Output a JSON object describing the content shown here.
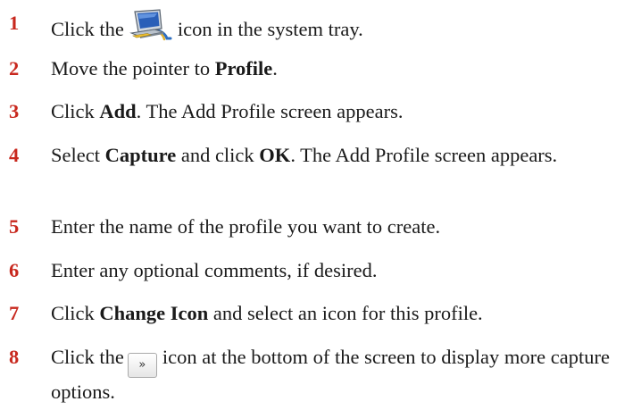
{
  "steps": [
    {
      "number": "1",
      "before": "Click the",
      "after": "icon in the system tray.",
      "icon": "network-monitor-icon"
    },
    {
      "number": "2",
      "before": "Move the pointer to ",
      "bold": "Profile",
      "after": "."
    },
    {
      "number": "3",
      "before": "Click ",
      "bold": "Add",
      "after": ". The Add Profile screen appears."
    },
    {
      "number": "4",
      "before": "Select ",
      "bold": "Capture",
      "middle": " and click ",
      "bold2": "OK",
      "after": ". The Add Profile screen appears."
    },
    {
      "number": "5",
      "text": "Enter the name of the profile you want to create."
    },
    {
      "number": "6",
      "text": "Enter any optional comments, if desired."
    },
    {
      "number": "7",
      "before": "Click ",
      "bold": "Change Icon",
      "after": " and select an icon for this profile."
    },
    {
      "number": "8",
      "before": "Click the",
      "icon": "expand-options-icon",
      "icon_glyph": "»",
      "after": "icon at the bottom of the screen to display more capture options."
    }
  ],
  "colors": {
    "step_number": "#c8281e",
    "text": "#1a1a1a",
    "background": "#ffffff"
  }
}
